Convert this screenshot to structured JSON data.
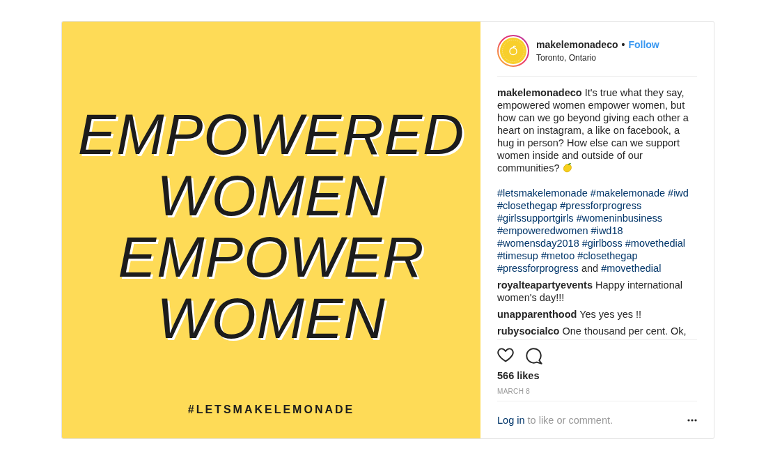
{
  "post": {
    "image": {
      "headline": [
        "EMPOWERED",
        "WOMEN",
        "EMPOWER",
        "WOMEN"
      ],
      "hashtag": "#LETSMAKELEMONADE"
    },
    "header": {
      "username": "makelemonadeco",
      "separator": "•",
      "follow": "Follow",
      "location": "Toronto, Ontario"
    },
    "caption": {
      "username": "makelemonadeco",
      "text": "It's true what they say,\nempowered women empower women, but\nhow can we go beyond giving each other a\nheart on instagram, a like on facebook, a\nhug in person? How else can we support\nwomen inside and outside of our\ncommunities?",
      "hashtag_lines": [
        [
          {
            "kind": "tag",
            "text": "#letsmakelemonade"
          },
          {
            "kind": "tag",
            "text": "#makelemonade"
          },
          {
            "kind": "tag",
            "text": "#iwd"
          }
        ],
        [
          {
            "kind": "tag",
            "text": "#closethegap"
          },
          {
            "kind": "tag",
            "text": "#pressforprogress"
          }
        ],
        [
          {
            "kind": "tag",
            "text": "#girlssupportgirls"
          },
          {
            "kind": "tag",
            "text": "#womeninbusiness"
          }
        ],
        [
          {
            "kind": "tag",
            "text": "#empoweredwomen"
          },
          {
            "kind": "tag",
            "text": "#iwd18"
          }
        ],
        [
          {
            "kind": "tag",
            "text": "#womensday2018"
          },
          {
            "kind": "tag",
            "text": "#girlboss"
          },
          {
            "kind": "tag",
            "text": "#movethedial"
          }
        ],
        [
          {
            "kind": "tag",
            "text": "#timesup"
          },
          {
            "kind": "tag",
            "text": "#metoo"
          },
          {
            "kind": "tag",
            "text": "#closethegap"
          }
        ],
        [
          {
            "kind": "tag",
            "text": "#pressforprogress"
          },
          {
            "kind": "word",
            "text": "and"
          },
          {
            "kind": "tag",
            "text": "#movethedial"
          }
        ]
      ]
    },
    "comments": [
      {
        "username": "royalteapartyevents",
        "text": "Happy international women's day!!!"
      },
      {
        "username": "unapparenthood",
        "text": "Yes yes yes !!"
      },
      {
        "username": "rubysocialco",
        "text": "One thousand per cent. Ok,"
      }
    ],
    "likes": "566 likes",
    "date": "MARCH 8",
    "login": {
      "link": "Log in",
      "prompt": "to like or comment."
    }
  }
}
